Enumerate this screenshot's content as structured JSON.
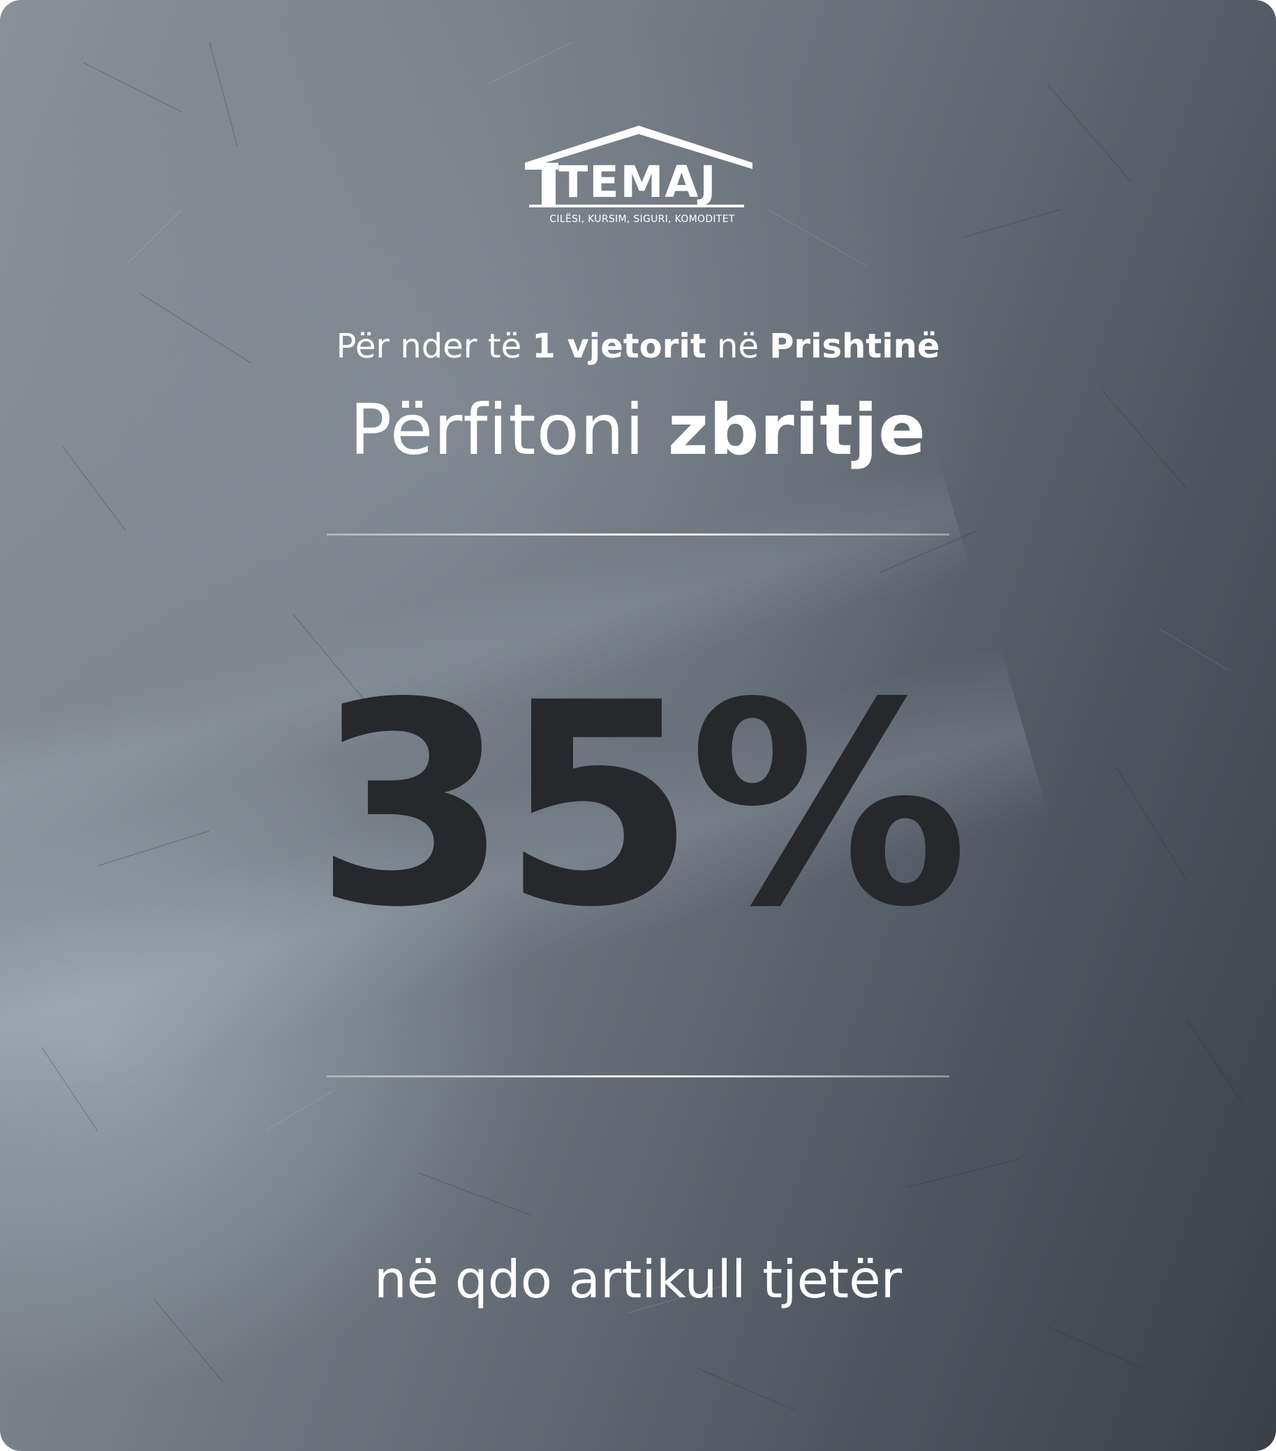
{
  "brand": {
    "name": "TEMAJ",
    "tagline": "CILËSI, KURSIM, SIGURI, KOMODITET"
  },
  "promo": {
    "subtitle_part1": "Për nder të ",
    "subtitle_bold1": "1 vjetorit",
    "subtitle_part2": " në ",
    "subtitle_bold2": "Prishtinë",
    "headline_light": "Përfitoni ",
    "headline_bold": "zbritje",
    "discount": "35%",
    "footer": "në qdo artikull tjetër"
  },
  "colors": {
    "text": "#ffffff",
    "discount": "#26282c",
    "background_light": "#8a9098",
    "background_dark": "#3b4048"
  }
}
